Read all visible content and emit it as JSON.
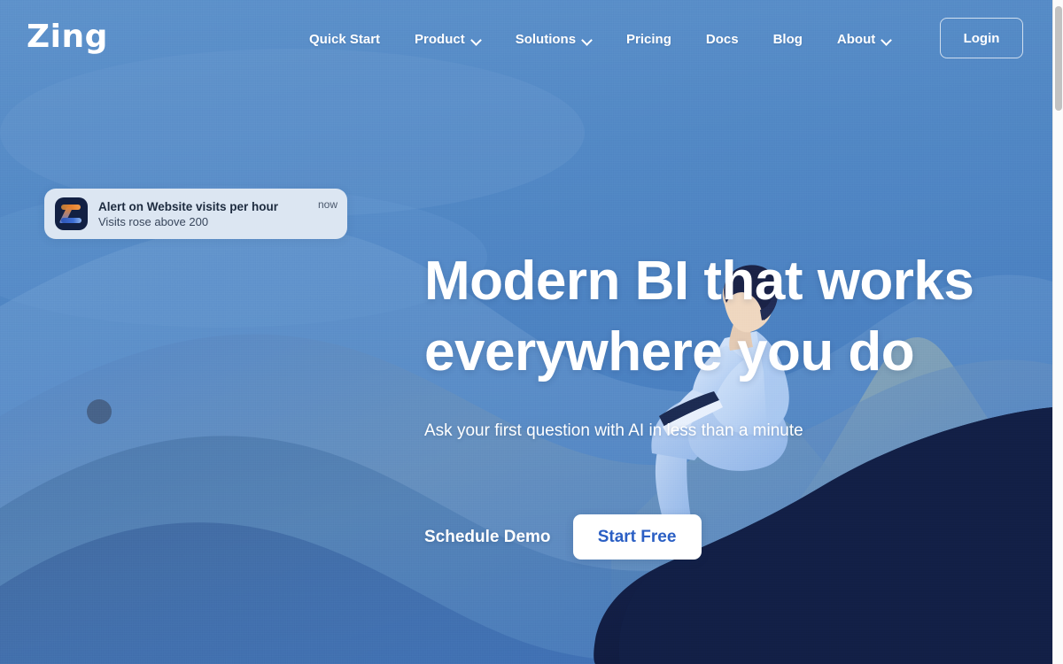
{
  "brand": {
    "logo_text": "Zing"
  },
  "nav": {
    "items": [
      {
        "label": "Quick Start",
        "has_chevron": false
      },
      {
        "label": "Product",
        "has_chevron": true
      },
      {
        "label": "Solutions",
        "has_chevron": true
      },
      {
        "label": "Pricing",
        "has_chevron": false
      },
      {
        "label": "Docs",
        "has_chevron": false
      },
      {
        "label": "Blog",
        "has_chevron": false
      },
      {
        "label": "About",
        "has_chevron": true
      }
    ],
    "login_label": "Login"
  },
  "notification": {
    "app_icon": "zing-app-icon",
    "title": "Alert on Website visits per hour",
    "subtitle": "Visits rose above 200",
    "timestamp": "now"
  },
  "hero": {
    "headline_line1": "Modern BI that works",
    "headline_line2": "everywhere you do",
    "subheadline": "Ask your first question with AI in less than a minute",
    "cta_secondary": "Schedule Demo",
    "cta_primary": "Start Free"
  },
  "illustration": {
    "description": "person-sitting-on-boulder-with-laptop",
    "scene": "layered-blue-hills-and-mountains"
  },
  "colors": {
    "sky_top": "#5c90c9",
    "sky_bottom": "#3f73b8",
    "hill_light": "#6d9cd0",
    "hill_mid": "#4f82c1",
    "hill_dark": "#3c6bb0",
    "hill_deep": "#35609f",
    "mountain_sage": "#93a79b",
    "boulder_navy": "#131f45",
    "accent_blue": "#2b5fc4",
    "toast_bg": "#dce6f2",
    "text_white": "#ffffff",
    "icon_orange": "#e8822e",
    "icon_navy": "#122043"
  }
}
